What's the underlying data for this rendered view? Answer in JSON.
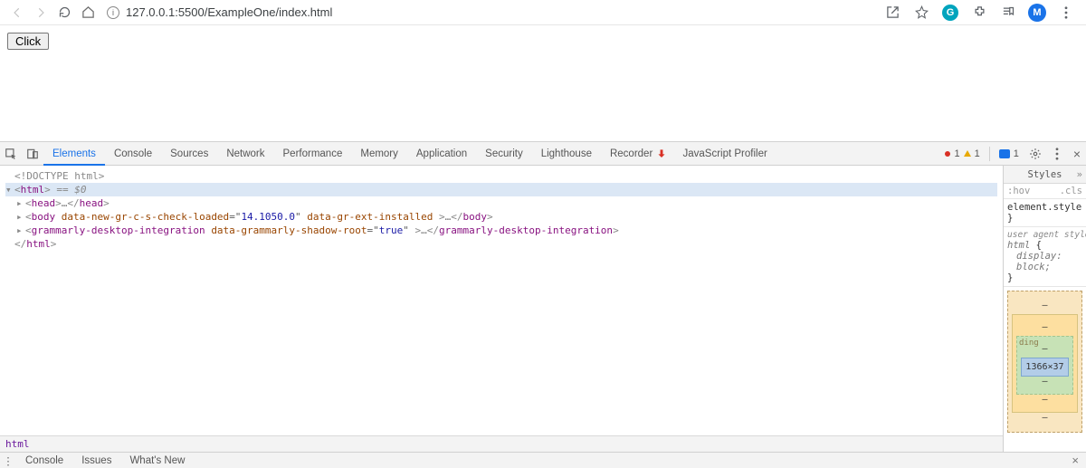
{
  "toolbar": {
    "url": "127.0.0.1:5500/ExampleOne/index.html",
    "avatar_letter": "M",
    "ext_letter": "G"
  },
  "page": {
    "button_label": "Click"
  },
  "devtools": {
    "tabs": [
      "Elements",
      "Console",
      "Sources",
      "Network",
      "Performance",
      "Memory",
      "Application",
      "Security",
      "Lighthouse",
      "Recorder",
      "JavaScript Profiler"
    ],
    "active_tab": "Elements",
    "badges": {
      "errors": 1,
      "warnings": 1,
      "issues": 1
    },
    "dom_lines": {
      "doctype_open": "<!DOCTYPE ",
      "doctype_name": "html",
      "doctype_close": ">",
      "html_open_punct_l": "<",
      "html_tag": "html",
      "html_open_punct_r": ">",
      "sel_marker": " == $0",
      "head_open_l": "<",
      "head_tag": "head",
      "head_open_r": ">",
      "ellipsis": "…",
      "head_close_l": "</",
      "head_close_r": ">",
      "body_open_l": "<",
      "body_tag": "body",
      "body_attr1_name": "data-new-gr-c-s-check-loaded",
      "body_attr1_eq": "=\"",
      "body_attr1_val": "14.1050.0",
      "body_attr1_q2": "\"",
      "body_attr2_name": "data-gr-ext-installed",
      "body_open_r": ">",
      "body_close_l": "</",
      "body_close_r": ">",
      "gram_open_l": "<",
      "gram_tag": "grammarly-desktop-integration",
      "gram_attr_name": "data-grammarly-shadow-root",
      "gram_attr_eq": "=\"",
      "gram_attr_val": "true",
      "gram_attr_q2": "\"",
      "gram_open_r": ">",
      "gram_close_l": "</",
      "gram_close_r": ">",
      "html_close_l": "</",
      "html_close_r": ">"
    },
    "breadcrumb": "html",
    "styles": {
      "pane_title": "Styles",
      "filter": ":hov",
      "cls": ".cls",
      "rule1_sel": "element.style",
      "rule1_brace_open": " {",
      "rule1_brace_close": "}",
      "ua_label": "user agent stylesheet",
      "rule2_sel": "html",
      "rule2_open": " {",
      "rule2_prop": "display",
      "rule2_colon": ":",
      "rule2_val": "block;",
      "rule2_close": "}",
      "box_dims": "1366×37",
      "dash": "–"
    },
    "drawer_tabs": [
      "Console",
      "Issues",
      "What's New"
    ]
  }
}
